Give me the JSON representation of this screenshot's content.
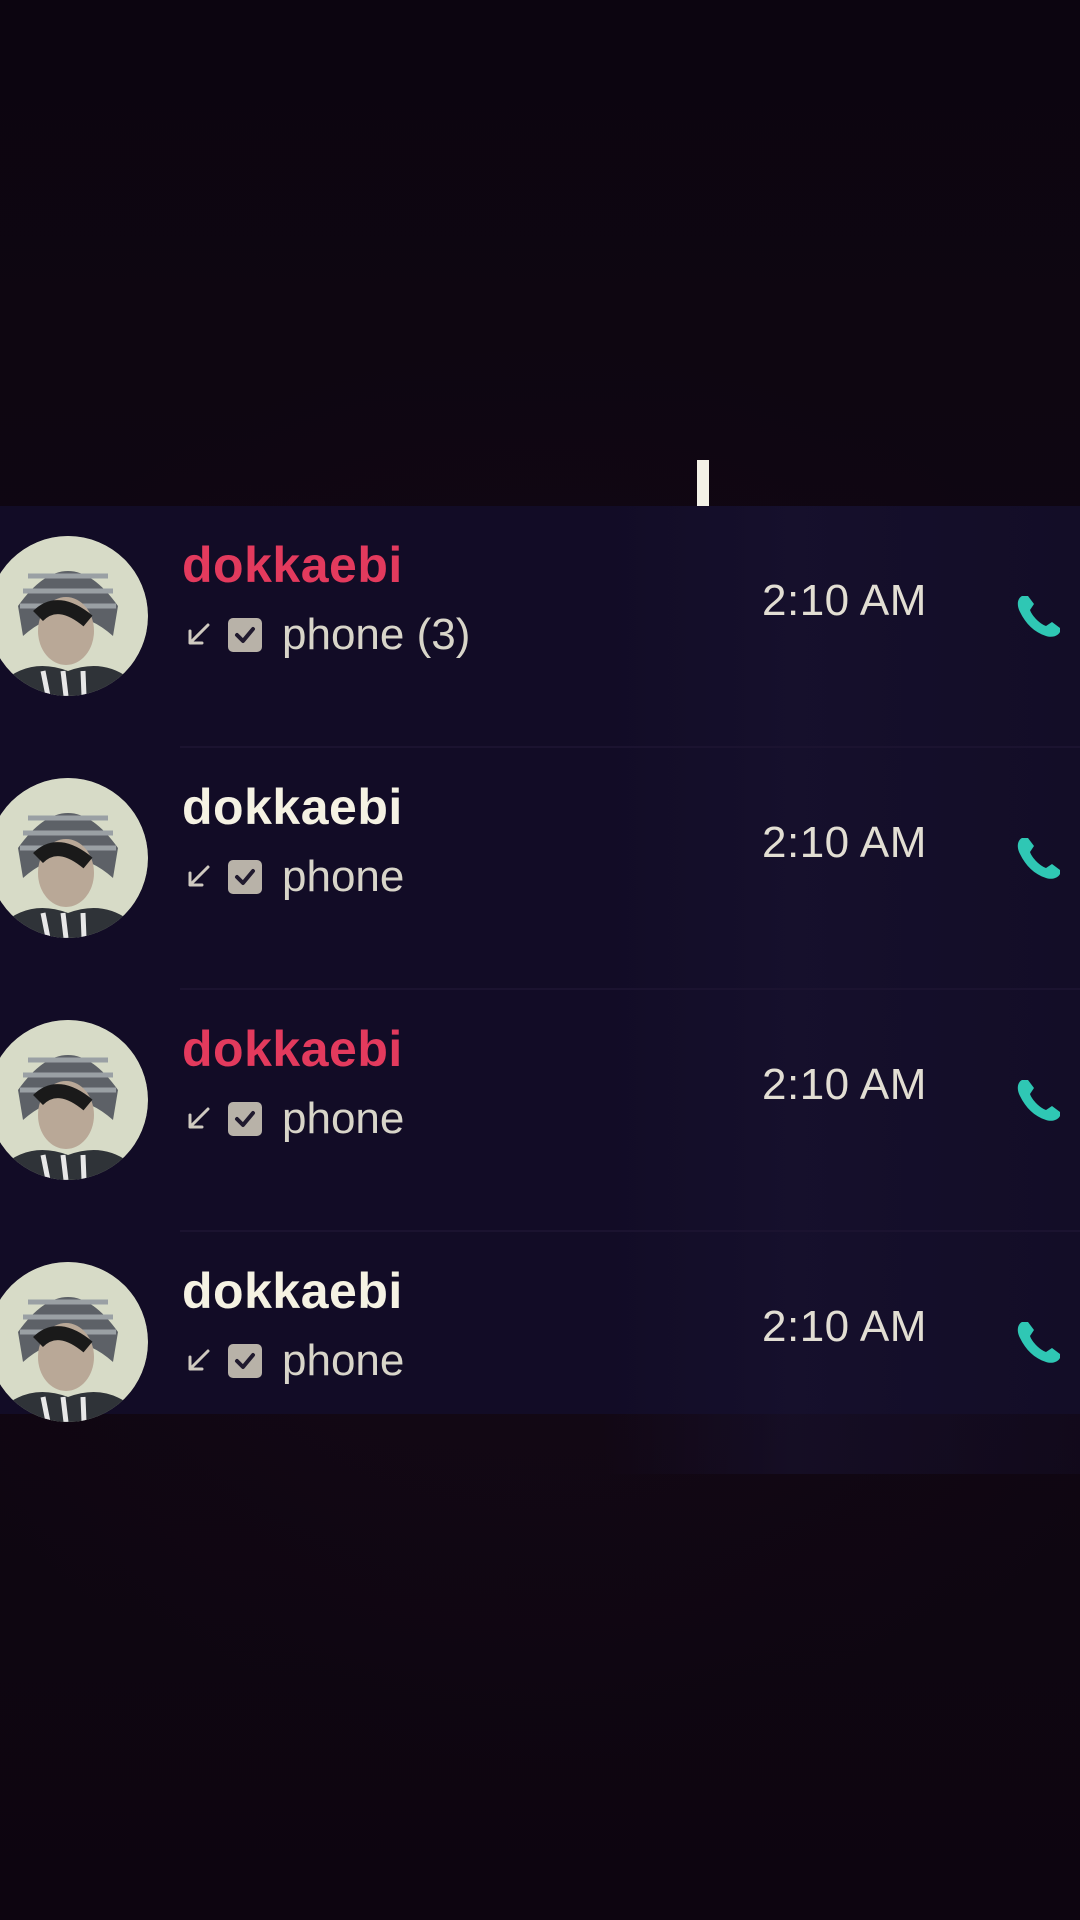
{
  "call_log": {
    "entries": [
      {
        "name": "dokkaebi",
        "status": "missed",
        "type_label": "phone (3)",
        "time": "2:10 AM"
      },
      {
        "name": "dokkaebi",
        "status": "normal",
        "type_label": "phone",
        "time": "2:10 AM"
      },
      {
        "name": "dokkaebi",
        "status": "missed",
        "type_label": "phone",
        "time": "2:10 AM"
      },
      {
        "name": "dokkaebi",
        "status": "normal",
        "type_label": "phone",
        "time": "2:10 AM"
      }
    ],
    "icons": {
      "direction": "incoming-arrow-icon",
      "sim": "checkbox-icon",
      "call": "phone-icon"
    }
  },
  "colors": {
    "missed_name": "#e33a5d",
    "normal_name": "#f5f2e3",
    "call_icon": "#2fc7b4",
    "list_bg": "#120c26",
    "page_bg": "#0d0510"
  }
}
